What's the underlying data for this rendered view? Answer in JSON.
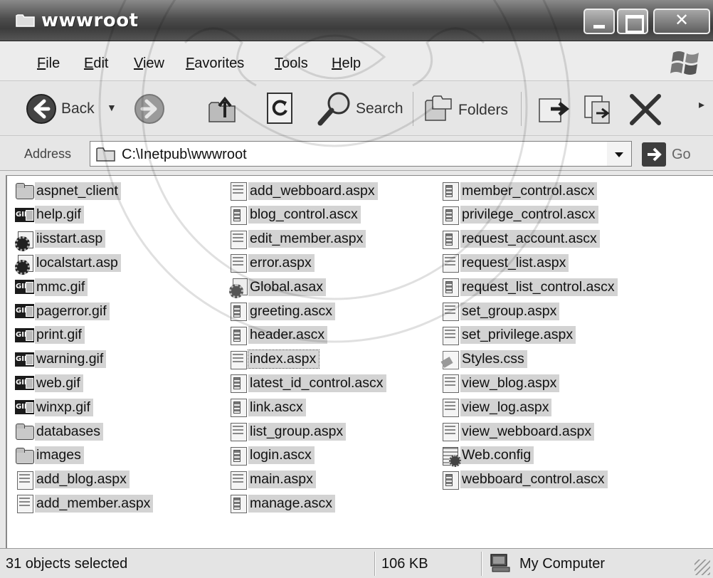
{
  "window": {
    "title": "wwwroot",
    "icon": "folder-icon"
  },
  "menu": [
    "File",
    "Edit",
    "View",
    "Favorites",
    "Tools",
    "Help"
  ],
  "toolbar": {
    "back_label": "Back",
    "search_label": "Search",
    "folders_label": "Folders"
  },
  "address": {
    "label": "Address",
    "path": "C:\\Inetpub\\wwwroot",
    "go_label": "Go"
  },
  "files": {
    "col1": [
      {
        "name": "aspnet_client",
        "icon": "folder-icon"
      },
      {
        "name": "help.gif",
        "icon": "gif-icon"
      },
      {
        "name": "iisstart.asp",
        "icon": "asp-icon"
      },
      {
        "name": "localstart.asp",
        "icon": "asp-icon"
      },
      {
        "name": "mmc.gif",
        "icon": "gif-icon"
      },
      {
        "name": "pagerror.gif",
        "icon": "gif-icon"
      },
      {
        "name": "print.gif",
        "icon": "gif-icon"
      },
      {
        "name": "warning.gif",
        "icon": "gif-icon"
      },
      {
        "name": "web.gif",
        "icon": "gif-icon"
      },
      {
        "name": "winxp.gif",
        "icon": "gif-icon"
      },
      {
        "name": "databases",
        "icon": "folder-icon"
      },
      {
        "name": "images",
        "icon": "folder-icon"
      },
      {
        "name": "add_blog.aspx",
        "icon": "aspx-icon"
      },
      {
        "name": "add_member.aspx",
        "icon": "aspx-icon"
      }
    ],
    "col2": [
      {
        "name": "add_webboard.aspx",
        "icon": "aspx-icon"
      },
      {
        "name": "blog_control.ascx",
        "icon": "ascx-icon"
      },
      {
        "name": "edit_member.aspx",
        "icon": "aspx-icon"
      },
      {
        "name": "error.aspx",
        "icon": "aspx-icon"
      },
      {
        "name": "Global.asax",
        "icon": "asax-icon"
      },
      {
        "name": "greeting.ascx",
        "icon": "ascx-icon"
      },
      {
        "name": "header.ascx",
        "icon": "ascx-icon"
      },
      {
        "name": "index.aspx",
        "icon": "aspx-icon"
      },
      {
        "name": "latest_id_control.ascx",
        "icon": "ascx-icon"
      },
      {
        "name": "link.ascx",
        "icon": "ascx-icon"
      },
      {
        "name": "list_group.aspx",
        "icon": "aspx-icon"
      },
      {
        "name": "login.ascx",
        "icon": "ascx-icon"
      },
      {
        "name": "main.aspx",
        "icon": "aspx-icon"
      },
      {
        "name": "manage.ascx",
        "icon": "ascx-icon"
      }
    ],
    "col3": [
      {
        "name": "member_control.ascx",
        "icon": "ascx-icon"
      },
      {
        "name": "privilege_control.ascx",
        "icon": "ascx-icon"
      },
      {
        "name": "request_account.ascx",
        "icon": "ascx-icon"
      },
      {
        "name": "request_list.aspx",
        "icon": "aspx-icon"
      },
      {
        "name": "request_list_control.ascx",
        "icon": "ascx-icon"
      },
      {
        "name": "set_group.aspx",
        "icon": "aspx-icon"
      },
      {
        "name": "set_privilege.aspx",
        "icon": "aspx-icon"
      },
      {
        "name": "Styles.css",
        "icon": "css-icon"
      },
      {
        "name": "view_blog.aspx",
        "icon": "aspx-icon"
      },
      {
        "name": "view_log.aspx",
        "icon": "aspx-icon"
      },
      {
        "name": "view_webboard.aspx",
        "icon": "aspx-icon"
      },
      {
        "name": "Web.config",
        "icon": "config-icon"
      },
      {
        "name": "webboard_control.ascx",
        "icon": "ascx-icon"
      }
    ]
  },
  "status": {
    "selected": "31 objects selected",
    "size": "106 KB",
    "zone": "My Computer"
  }
}
